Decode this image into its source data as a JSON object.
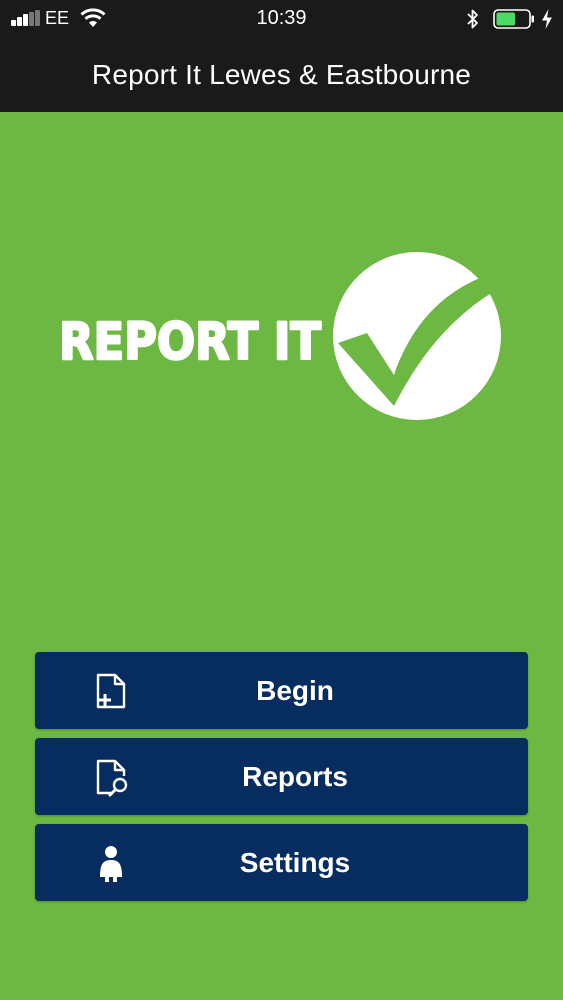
{
  "status_bar": {
    "carrier": "EE",
    "time": "10:39",
    "signal_bars_filled": 3,
    "signal_bars_total": 5,
    "battery_level": 0.6,
    "icons": [
      "signal-icon",
      "wifi-icon",
      "bluetooth-icon",
      "battery-icon",
      "charging-icon"
    ]
  },
  "header": {
    "title": "Report It Lewes & Eastbourne"
  },
  "logo": {
    "text": "REPORT IT",
    "icon": "checkmark-circle-icon"
  },
  "menu": {
    "items": [
      {
        "label": "Begin",
        "icon": "new-document-icon"
      },
      {
        "label": "Reports",
        "icon": "search-document-icon"
      },
      {
        "label": "Settings",
        "icon": "person-icon"
      }
    ]
  },
  "colors": {
    "background": "#6cb843",
    "header": "#1a1a1a",
    "button": "#072c5f",
    "text": "#ffffff"
  }
}
